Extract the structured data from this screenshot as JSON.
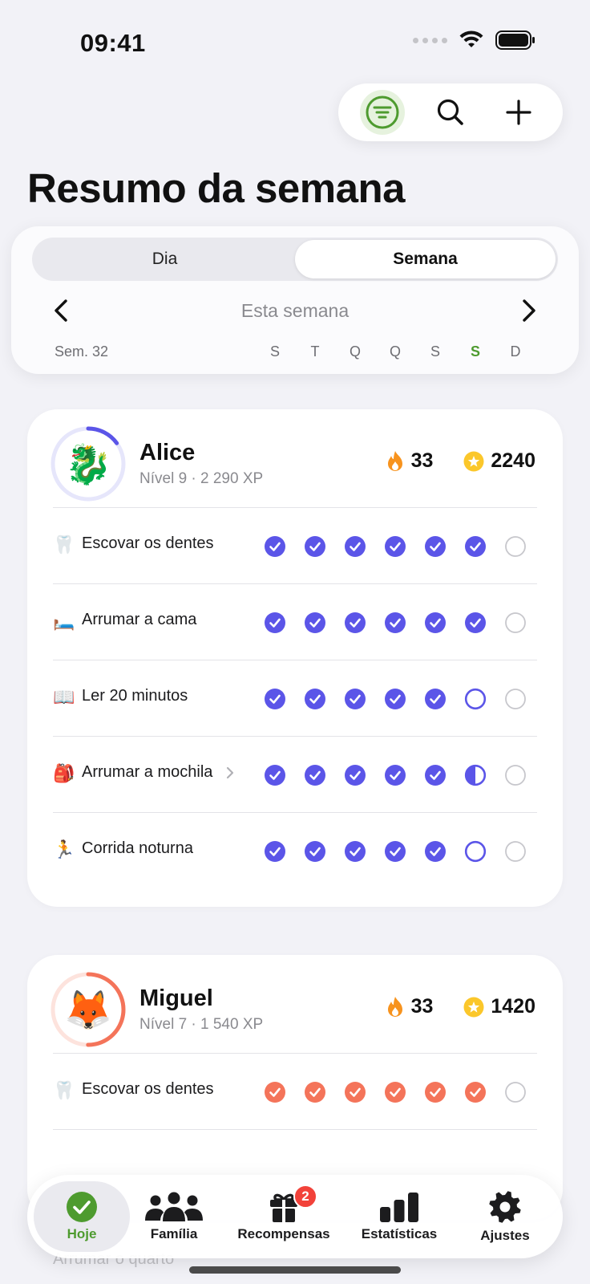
{
  "status_bar": {
    "time": "09:41"
  },
  "header": {
    "title": "Resumo da semana"
  },
  "week_selector": {
    "segments": [
      {
        "label": "Dia",
        "active": false
      },
      {
        "label": "Semana",
        "active": true
      }
    ],
    "period_label": "Esta semana",
    "week_number": "Sem. 32",
    "days": [
      "S",
      "T",
      "Q",
      "Q",
      "S",
      "S",
      "D"
    ],
    "today_index": 5
  },
  "colors": {
    "accent_green": "#4E9B2F",
    "alice_accent": "#5B55E8",
    "miguel_accent": "#F4745A",
    "streak": "#F7931E",
    "star": "#FBC72B"
  },
  "people": [
    {
      "name": "Alice",
      "level": "Nível 9 · 2 290 XP",
      "avatar_icon": "dragon-emoji",
      "avatar": "🐉",
      "level_progress": 0.15,
      "streak": "33",
      "points": "2240",
      "habits": [
        {
          "emoji": "🦷",
          "name": "Escovar os dentes",
          "has_chevron": false,
          "days": [
            "done",
            "done",
            "done",
            "done",
            "done",
            "done",
            "empty"
          ]
        },
        {
          "emoji": "🛏️",
          "name": "Arrumar a cama",
          "has_chevron": false,
          "days": [
            "done",
            "done",
            "done",
            "done",
            "done",
            "done",
            "empty"
          ]
        },
        {
          "emoji": "📖",
          "name": "Ler 20 minutos",
          "has_chevron": false,
          "days": [
            "done",
            "done",
            "done",
            "done",
            "done",
            "pending",
            "empty"
          ]
        },
        {
          "emoji": "🎒",
          "name": "Arrumar a mochila",
          "has_chevron": true,
          "days": [
            "done",
            "done",
            "done",
            "done",
            "done",
            "half",
            "empty"
          ]
        },
        {
          "emoji": "🏃",
          "name": "Corrida noturna",
          "has_chevron": false,
          "days": [
            "done",
            "done",
            "done",
            "done",
            "done",
            "pending",
            "empty"
          ]
        }
      ]
    },
    {
      "name": "Miguel",
      "level": "Nível 7 · 1 540 XP",
      "avatar_icon": "fox-emoji",
      "avatar": "🦊",
      "level_progress": 0.5,
      "streak": "33",
      "points": "1420",
      "habits": [
        {
          "emoji": "🦷",
          "name": "Escovar os dentes",
          "has_chevron": false,
          "days": [
            "done",
            "done",
            "done",
            "done",
            "done",
            "done",
            "empty"
          ]
        }
      ]
    }
  ],
  "peek_text": "Arrumar o quarto",
  "tab_bar": {
    "tabs": [
      {
        "label": "Hoje",
        "icon": "checkmark-circle-icon",
        "active": true
      },
      {
        "label": "Família",
        "icon": "people-icon",
        "active": false
      },
      {
        "label": "Recompensas",
        "icon": "gift-icon",
        "active": false,
        "badge": "2"
      },
      {
        "label": "Estatísticas",
        "icon": "bar-chart-icon",
        "active": false
      },
      {
        "label": "Ajustes",
        "icon": "gear-icon",
        "active": false
      }
    ]
  }
}
